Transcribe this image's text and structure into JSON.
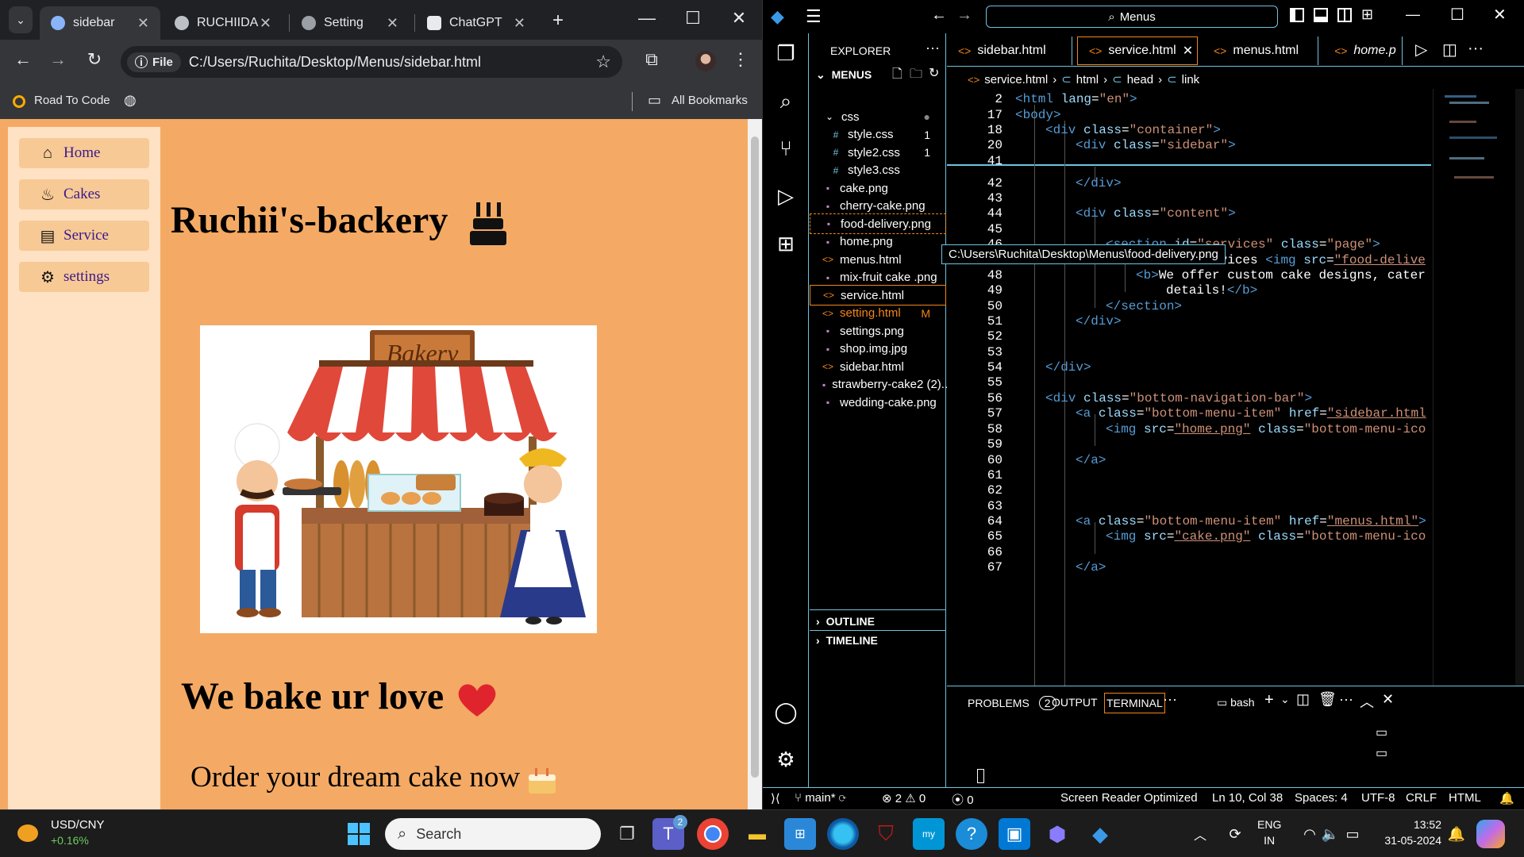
{
  "browser": {
    "tabs": [
      {
        "label": "sidebar",
        "active": true
      },
      {
        "label": "RUCHIIDA",
        "active": false
      },
      {
        "label": "Setting",
        "active": false
      },
      {
        "label": "ChatGPT",
        "active": false
      }
    ],
    "url": "C:/Users/Ruchita/Desktop/Menus/sidebar.html",
    "url_chip": "File",
    "bookmarks": {
      "left": "Road To Code",
      "right": "All Bookmarks"
    }
  },
  "page": {
    "sidebar": [
      {
        "label": "Home",
        "icon": "home-icon"
      },
      {
        "label": "Cakes",
        "icon": "cake-icon"
      },
      {
        "label": "Service",
        "icon": "document-icon"
      },
      {
        "label": "settings",
        "icon": "gear-icon"
      }
    ],
    "title": "Ruchii's-backery",
    "image_sign": "Bakery",
    "tagline": "We bake ur love",
    "order_text": "Order your dream cake now",
    "colors": {
      "page_bg": "#f4aa64",
      "sidebar_bg": "#ffe1c4",
      "button_bg": "#f7c995",
      "link_text": "#3a1a8c"
    }
  },
  "vscode": {
    "command_center": "Menus",
    "explorer_title": "EXPLORER",
    "folder": "MENUS",
    "files": [
      {
        "name": "css",
        "type": "folder",
        "badge": "●"
      },
      {
        "name": "style.css",
        "type": "css",
        "badge": "1"
      },
      {
        "name": "style2.css",
        "type": "css",
        "badge": "1"
      },
      {
        "name": "style3.css",
        "type": "css",
        "badge": ""
      },
      {
        "name": "cake.png",
        "type": "img",
        "badge": ""
      },
      {
        "name": "cherry-cake.png",
        "type": "img",
        "badge": ""
      },
      {
        "name": "food-delivery.png",
        "type": "img",
        "badge": ""
      },
      {
        "name": "home.png",
        "type": "img",
        "badge": ""
      },
      {
        "name": "menus.html",
        "type": "html",
        "badge": ""
      },
      {
        "name": "mix-fruit cake .png",
        "type": "img",
        "badge": ""
      },
      {
        "name": "service.html",
        "type": "html",
        "badge": ""
      },
      {
        "name": "setting.html",
        "type": "html",
        "badge": "M"
      },
      {
        "name": "settings.png",
        "type": "img",
        "badge": ""
      },
      {
        "name": "shop.img.jpg",
        "type": "img",
        "badge": ""
      },
      {
        "name": "sidebar.html",
        "type": "html",
        "badge": ""
      },
      {
        "name": "strawberry-cake2 (2)....",
        "type": "img",
        "badge": ""
      },
      {
        "name": "wedding-cake.png",
        "type": "img",
        "badge": ""
      }
    ],
    "outline": "OUTLINE",
    "timeline": "TIMELINE",
    "tooltip": "C:\\Users\\Ruchita\\Desktop\\Menus\\food-delivery.png",
    "editor_tabs": [
      "sidebar.html",
      "service.html",
      "menus.html",
      "home.p"
    ],
    "breadcrumb": [
      "service.html",
      "html",
      "head",
      "link"
    ],
    "line_numbers": [
      "2",
      "17",
      "18",
      "20",
      "41",
      "42",
      "43",
      "44",
      "45",
      "46",
      "47",
      "48",
      "49",
      "50",
      "51",
      "52",
      "53",
      "54",
      "55",
      "56",
      "57",
      "58",
      "59",
      "60",
      "61",
      "62",
      "63",
      "64",
      "65",
      "66",
      "67"
    ],
    "panel_tabs": {
      "problems": "PROBLEMS",
      "problems_count": "2",
      "output": "OUTPUT",
      "terminal": "TERMINAL",
      "shell": "bash"
    },
    "status": {
      "branch": "main*",
      "errors": "2",
      "warnings": "0",
      "ports": "0",
      "reader": "Screen Reader Optimized",
      "position": "Ln 10, Col 38",
      "spaces": "Spaces: 4",
      "encoding": "UTF-8",
      "eol": "CRLF",
      "language": "HTML"
    }
  },
  "taskbar": {
    "ticker_name": "USD/CNY",
    "ticker_change": "+0.16%",
    "search_placeholder": "Search",
    "teams_badge": "2",
    "lang": "ENG",
    "lang_region": "IN",
    "time": "13:52",
    "date": "31-05-2024"
  }
}
